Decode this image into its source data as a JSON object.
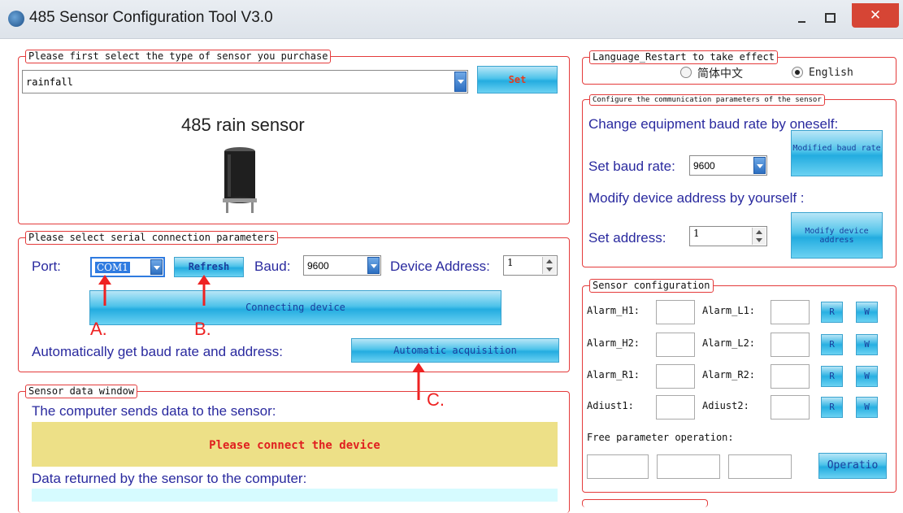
{
  "window": {
    "title": "485 Sensor Configuration Tool V3.0",
    "close_glyph": "✕"
  },
  "sensor_type": {
    "legend": "Please first select the type of sensor you purchase",
    "selected": "rainfall",
    "set_label": "Set",
    "sensor_name": "485 rain sensor"
  },
  "serial": {
    "legend": "Please select serial connection parameters",
    "port_label": "Port:",
    "port_value": "COM1",
    "refresh_label": "Refresh",
    "baud_label": "Baud:",
    "baud_value": "9600",
    "device_address_label": "Device Address:",
    "device_address_value": "1",
    "connect_label": "Connecting device",
    "annot_a": "A.",
    "annot_b": "B.",
    "annot_c": "C.",
    "auto_text": "Automatically get baud rate and address:",
    "auto_button": "Automatic acquisition"
  },
  "data_window": {
    "legend": "Sensor data window",
    "sends_label": "The computer sends data to the sensor:",
    "status_text": "Please connect the device",
    "returned_label": "Data returned by the sensor to the computer:"
  },
  "language": {
    "legend": "Language_Restart to take effect",
    "option_chinese": "简体中文",
    "option_english": "English",
    "selected": "English"
  },
  "comm": {
    "legend": "Configure the communication parameters of the sensor",
    "change_baud_text": "Change equipment baud rate by oneself:",
    "set_baud_label": "Set baud rate:",
    "baud_value": "9600",
    "modified_baud_button": "Modified baud rate",
    "modify_address_text": "Modify device address by yourself :",
    "set_address_label": "Set address:",
    "address_value": "1",
    "modify_address_button": "Modify device address"
  },
  "sensor_config": {
    "legend": "Sensor configuration",
    "rows": [
      {
        "left_label": "Alarm_H1:",
        "right_label": "Alarm_L1:",
        "read": "R",
        "write": "W"
      },
      {
        "left_label": "Alarm_H2:",
        "right_label": "Alarm_L2:",
        "read": "R",
        "write": "W"
      },
      {
        "left_label": "Alarm_R1:",
        "right_label": "Alarm_R2:",
        "read": "R",
        "write": "W"
      },
      {
        "left_label": "Adiust1:",
        "right_label": "Adiust2:",
        "read": "R",
        "write": "W"
      }
    ],
    "free_param_label": "Free parameter operation:",
    "operate_label": "Operatio"
  },
  "colors": {
    "accent_red": "#e43b3b",
    "button_blue": "#23ace0",
    "status_bg": "#ede087",
    "status_text": "#e02020"
  }
}
